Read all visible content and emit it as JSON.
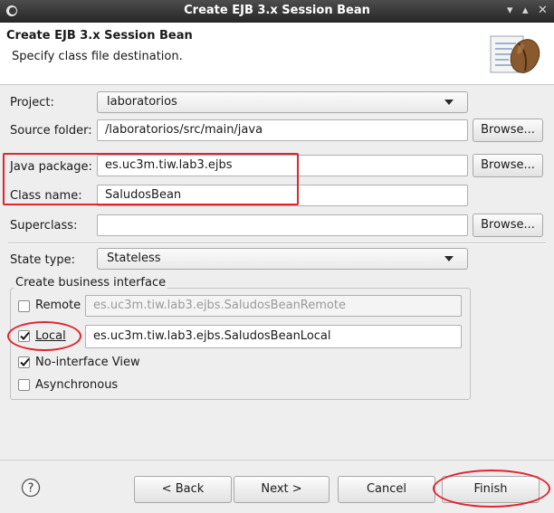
{
  "window": {
    "title": "Create EJB 3.x Session Bean",
    "controls": {
      "minimize": "▾",
      "maximize": "▴",
      "close": "✕"
    }
  },
  "header": {
    "title": "Create EJB 3.x Session Bean",
    "subtitle": "Specify class file destination."
  },
  "form": {
    "project": {
      "label": "Project:",
      "value": "laboratorios"
    },
    "source_folder": {
      "label": "Source folder:",
      "value": "/laboratorios/src/main/java",
      "browse": "Browse..."
    },
    "java_package": {
      "label": "Java package:",
      "value": "es.uc3m.tiw.lab3.ejbs",
      "browse": "Browse..."
    },
    "class_name": {
      "label": "Class name:",
      "value": "SaludosBean"
    },
    "superclass": {
      "label": "Superclass:",
      "value": "",
      "browse": "Browse..."
    },
    "state_type": {
      "label": "State type:",
      "value": "Stateless"
    }
  },
  "business_interface": {
    "title": "Create business interface",
    "remote": {
      "label": "Remote",
      "checked": false,
      "value": "es.uc3m.tiw.lab3.ejbs.SaludosBeanRemote"
    },
    "local": {
      "label": "Local",
      "checked": true,
      "value": "es.uc3m.tiw.lab3.ejbs.SaludosBeanLocal"
    },
    "no_interface": {
      "label": "No-interface View",
      "checked": true
    },
    "asynchronous": {
      "label": "Asynchronous",
      "checked": false
    }
  },
  "buttons": {
    "help": "?",
    "back": "< Back",
    "next": "Next >",
    "cancel": "Cancel",
    "finish": "Finish"
  },
  "colors": {
    "highlight": "#e0252f",
    "titlebar": "#333333"
  }
}
